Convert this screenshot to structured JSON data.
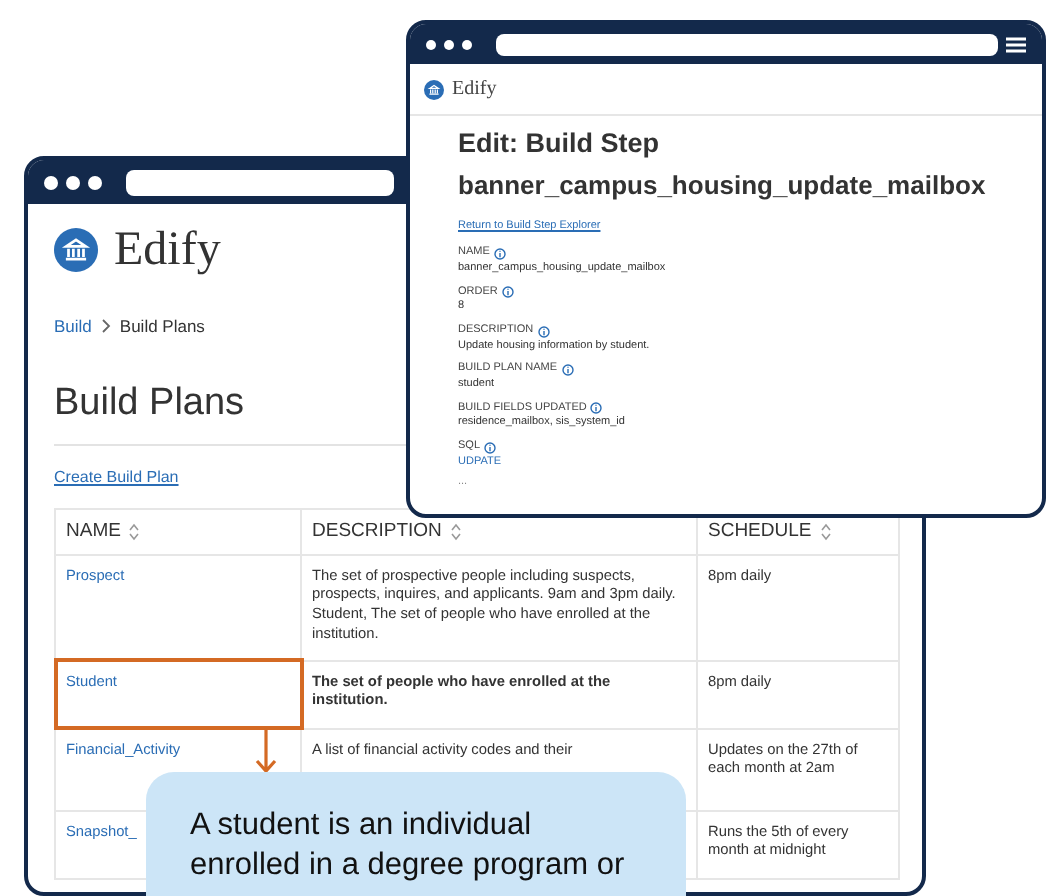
{
  "back_window": {
    "logo": "Edify",
    "breadcrumb": [
      {
        "label": "Build",
        "link": true
      },
      {
        "label": "Build Plans",
        "link": false
      }
    ],
    "page_title": "Build Plans",
    "create_link": "Create Build Plan",
    "table": {
      "columns": [
        "NAME",
        "DESCRIPTION",
        "SCHEDULE"
      ],
      "rows": [
        {
          "name": "Prospect",
          "description": "The set of prospective people including suspects, prospects, inquires, and applicants. 9am and 3pm daily. Student, The set of people who have enrolled at the institution.",
          "schedule": "8pm daily",
          "bold": false,
          "highlighted": false
        },
        {
          "name": "Student",
          "description": "The set of people who have enrolled at the institution.",
          "schedule": "8pm daily",
          "bold": true,
          "highlighted": true
        },
        {
          "name": "Financial_Activity",
          "description": "A list of financial activity codes and their",
          "schedule": "Updates on the 27th of each month at 2am",
          "bold": false,
          "highlighted": false
        },
        {
          "name": "Snapshot_",
          "schedule": "Runs the 5th of every month at midnight",
          "bold": false,
          "highlighted": false
        }
      ]
    }
  },
  "front_window": {
    "logo": "Edify",
    "title": "Edit: Build Step",
    "subtitle": "banner_campus_housing_update_mailbox",
    "return_link": "Return to Build Step Explorer",
    "fields": [
      {
        "label": "NAME",
        "value": "banner_campus_housing_update_mailbox",
        "kind": "text"
      },
      {
        "label": "ORDER",
        "value": "8",
        "kind": "text"
      },
      {
        "label": "DESCRIPTION",
        "value": "Update housing information by student.",
        "kind": "text"
      },
      {
        "label": "BUILD PLAN NAME",
        "value": "student",
        "kind": "text"
      },
      {
        "label": "BUILD FIELDS UPDATED",
        "value": "residence_mailbox, sis_system_id",
        "kind": "text"
      },
      {
        "label": "SQL",
        "value": "UDPATE",
        "kind": "code"
      }
    ],
    "more": "..."
  },
  "callout": {
    "text": "A student is an individual enrolled in a degree program or"
  }
}
